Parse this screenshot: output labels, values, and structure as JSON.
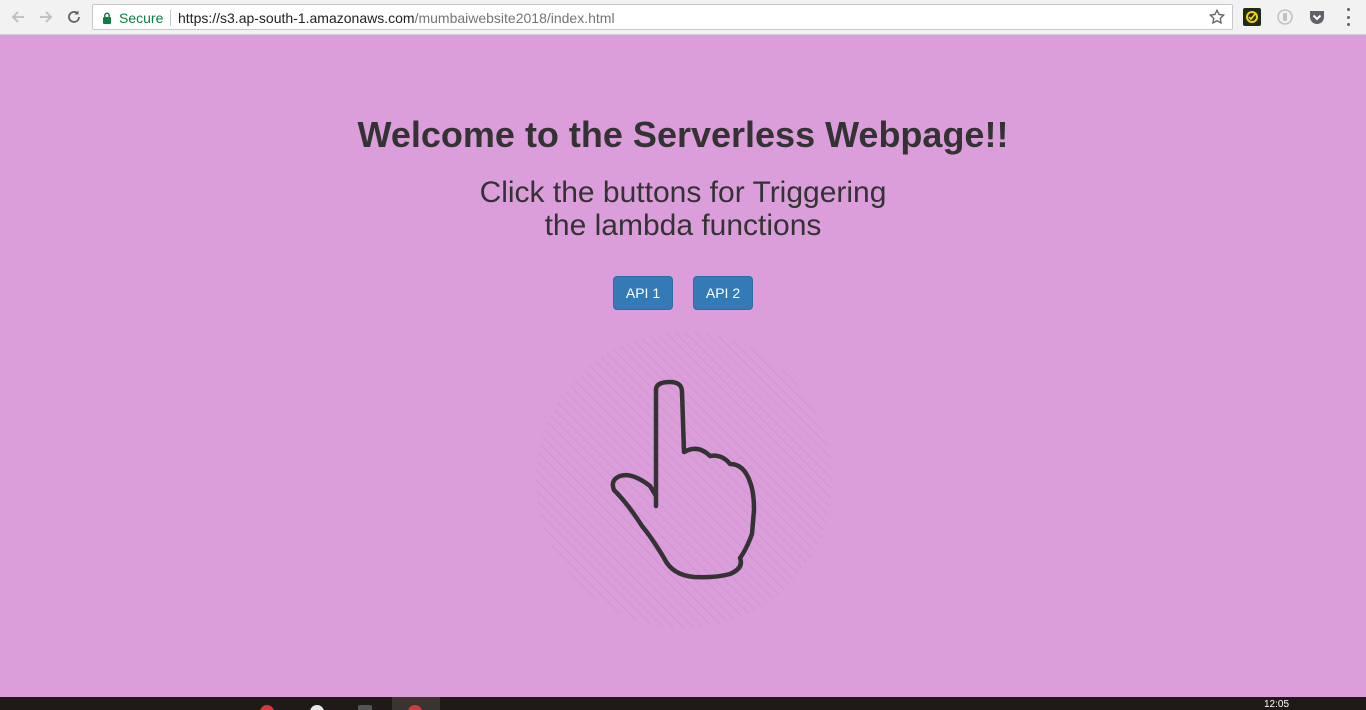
{
  "browser": {
    "security_label": "Secure",
    "url_host": "https://s3.ap-south-1.amazonaws.com",
    "url_path": "/mumbaiwebsite2018/index.html",
    "icons": [
      "back-arrow-icon",
      "forward-arrow-icon",
      "reload-icon",
      "lock-icon",
      "star-icon",
      "extension-check-icon",
      "extension-circle-icon",
      "pocket-icon",
      "menu-dots-icon"
    ]
  },
  "page": {
    "title": "Welcome to the Serverless Webpage!!",
    "subtitle_line1": "Click the buttons for Triggering",
    "subtitle_line2": "the lambda functions",
    "buttons": [
      {
        "label": "API 1"
      },
      {
        "label": "API 2"
      }
    ],
    "illustration": "pointing-hand-icon",
    "colors": {
      "background": "#dc9edb",
      "button": "#337ab7",
      "text": "#333333"
    }
  },
  "taskbar": {
    "clock": "12:05"
  }
}
